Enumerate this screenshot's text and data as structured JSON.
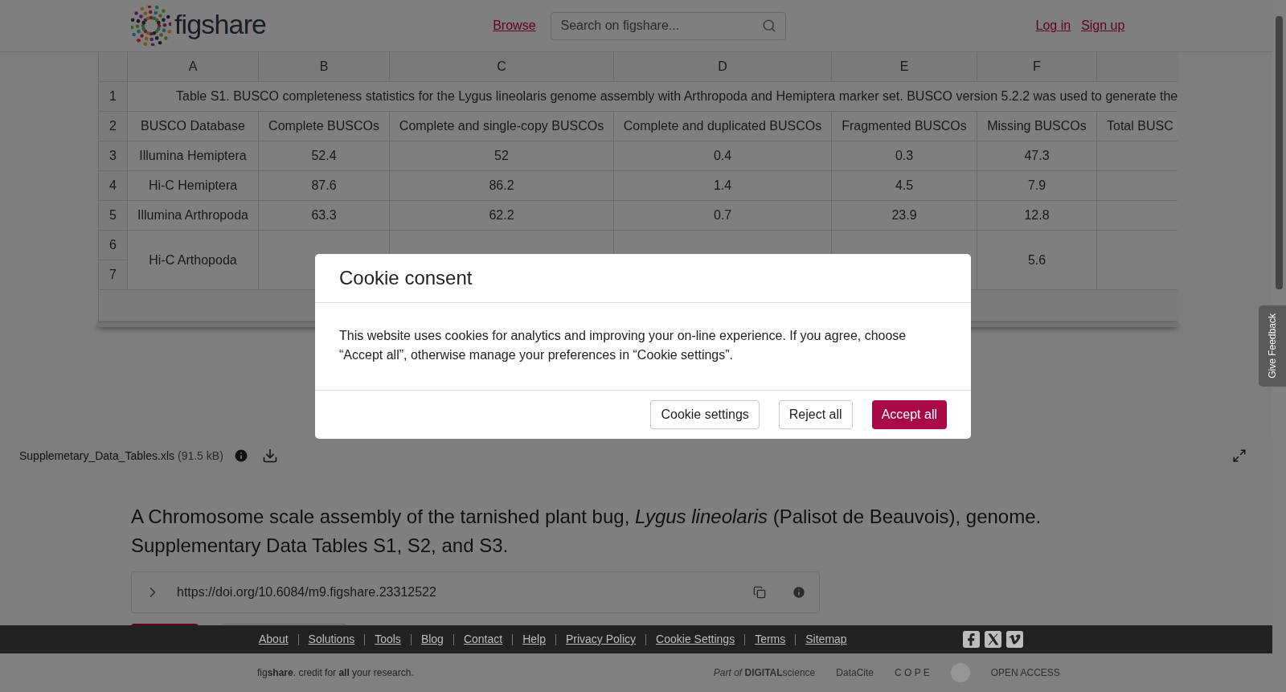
{
  "header": {
    "logo_text": "figshare",
    "browse": "Browse",
    "search": {
      "placeholder": "Search on figshare..."
    },
    "login": "Log in",
    "signup": "Sign up"
  },
  "spreadsheet": {
    "columns": [
      "A",
      "B",
      "C",
      "D",
      "E",
      "F"
    ],
    "rows": [
      {
        "kind": "title",
        "numbers": [
          "1"
        ],
        "text": "Table S1. BUSCO completeness statistics for the Lygus lineolaris genome assembly with Arthropoda and Hemiptera marker set. BUSCO version 5.2.2 was used to generate the"
      },
      {
        "kind": "cells",
        "numbers": [
          "2"
        ],
        "cells": [
          "BUSCO Database",
          "Complete BUSCOs",
          "Complete and single-copy BUSCOs",
          "Complete and duplicated BUSCOs",
          "Fragmented BUSCOs",
          "Missing BUSCOs",
          "Total BUSC"
        ]
      },
      {
        "kind": "cells",
        "numbers": [
          "3"
        ],
        "cells": [
          "Illumina Hemiptera",
          "52.4",
          "52",
          "0.4",
          "0.3",
          "47.3"
        ]
      },
      {
        "kind": "cells",
        "numbers": [
          "4"
        ],
        "cells": [
          "Hi-C Hemiptera",
          "87.6",
          "86.2",
          "1.4",
          "4.5",
          "7.9"
        ]
      },
      {
        "kind": "cells",
        "numbers": [
          "5"
        ],
        "cells": [
          "Illumina Arthropoda",
          "63.3",
          "62.2",
          "0.7",
          "23.9",
          "12.8"
        ]
      },
      {
        "kind": "cells",
        "numbers": [
          "6",
          "7"
        ],
        "cells": [
          "Hi-C Arthopoda",
          null,
          null,
          null,
          null,
          "5.6"
        ]
      }
    ]
  },
  "file": {
    "name": "Supplemetary_Data_Tables.xls",
    "size": "(91.5 kB)"
  },
  "article": {
    "title": "A Chromosome scale assembly of the tarnished plant bug, *Lygus lineolaris* (Palisot de Beauvois), genome. Supplementary Data Tables S1, S2, and S3.",
    "doi": "https://doi.org/10.6084/m9.figshare.23312522"
  },
  "feedback": "Give Feedback",
  "cookie_dialog": {
    "title": "Cookie consent",
    "body": "This website uses cookies for analytics and improving your on-line experience. If you agree, choose “Accept all”, otherwise manage your preferences in “Cookie settings”.",
    "buttons": [
      {
        "label": "Cookie settings",
        "kind": "secondary"
      },
      {
        "label": "Reject all",
        "kind": "secondary"
      },
      {
        "label": "Accept all",
        "kind": "primary"
      }
    ]
  },
  "footer": {
    "links": [
      "About",
      "Solutions",
      "Tools",
      "Blog",
      "Contact",
      "Help",
      "Privacy Policy",
      "Cookie Settings",
      "Terms",
      "Sitemap"
    ],
    "social": [
      {
        "kind": "facebook"
      },
      {
        "kind": "x"
      },
      {
        "kind": "vimeo"
      }
    ],
    "tagline": "fig**share**. credit for **all** your research.",
    "partners": [
      {
        "kind": "text",
        "text": "*Part of* **DIGITAL**science"
      },
      {
        "kind": "text",
        "text": "DataCite"
      },
      {
        "kind": "text",
        "text": "C O P E"
      },
      {
        "kind": "seal"
      },
      {
        "kind": "text",
        "text": "OPEN ACCESS"
      }
    ]
  }
}
